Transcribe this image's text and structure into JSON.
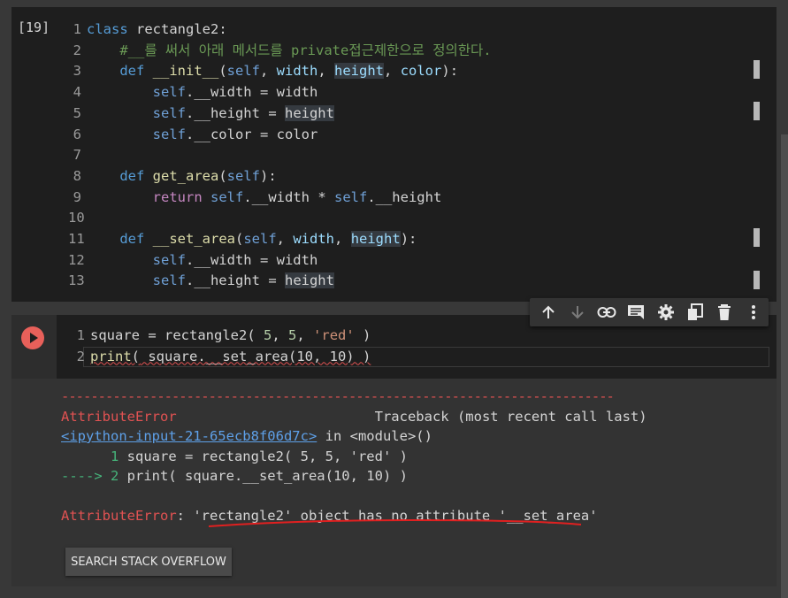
{
  "cell1": {
    "execution_count": "[19]",
    "line_numbers": [
      "1",
      "2",
      "3",
      "4",
      "5",
      "6",
      "7",
      "8",
      "9",
      "10",
      "11",
      "12",
      "13"
    ],
    "tokens": {
      "class_kw": "class",
      "class_name": "rectangle2",
      "colon": ":",
      "comment": "#__를 써서 아래 메서드를 private접근제한으로 정의한다.",
      "def_kw": "def",
      "init_name": "__init__",
      "self": "self",
      "width": "width",
      "height": "height",
      "color": "color",
      "dot_width": ".__width",
      "dot_height": ".__height",
      "dot_color": ".__color",
      "eq": " = ",
      "get_area": "get_area",
      "return_kw": "return",
      "star": " * ",
      "set_area": "__set_area",
      "open_paren": "(",
      "comma": ", ",
      "close_paren_colon": "):"
    }
  },
  "cell2": {
    "line_numbers": [
      "1",
      "2"
    ],
    "square": "square",
    "rect_call": "rectangle2",
    "n5": "5",
    "str_red": "'red'",
    "print": "print",
    "arg_expr": " square.__set_area(10, 10) ",
    "n10a": "10",
    "n10b": "10"
  },
  "toolbar": {
    "icons": [
      "move-up-icon",
      "move-down-icon",
      "link-icon",
      "comment-icon",
      "settings-icon",
      "mirror-cell-icon",
      "delete-icon",
      "more-icon"
    ]
  },
  "output": {
    "separator": "---------------------------------------------------------------------------",
    "error_name": "AttributeError",
    "traceback_label": "Traceback (most recent call last)",
    "input_link": "<ipython-input-21-65ecb8f06d7c>",
    "in_module": " in <module>()",
    "tb_line1_num": "      1",
    "tb_line1_code": " square = rectangle2( 5, 5, 'red' )",
    "tb_arrow": "----> 2",
    "tb_line2_code": " print( square.__set_area(10, 10) )",
    "final_error_name": "AttributeError",
    "final_error_msg": ": 'rectangle2' object has no attribute '__set_area'",
    "stack_overflow_button": "SEARCH STACK OVERFLOW"
  },
  "colors": {
    "background": "#383838",
    "editor": "#1e1e1e",
    "keyword": "#569cd6",
    "comment": "#6a9955",
    "string": "#ce9178",
    "error": "#e05252",
    "run_button": "#e8605a"
  }
}
